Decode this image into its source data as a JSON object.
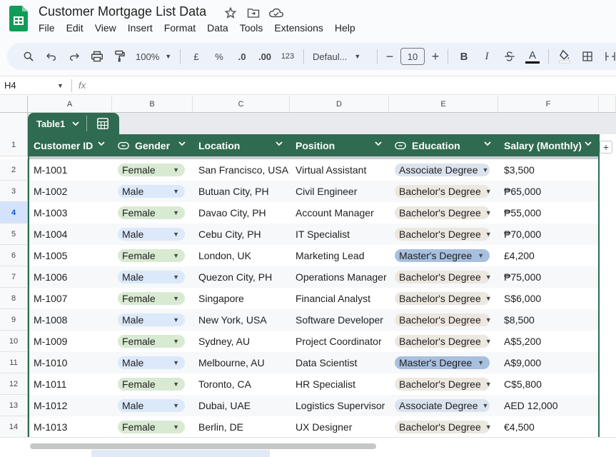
{
  "app": {
    "doc_title": "Customer Mortgage List Data",
    "brand_color": "#0f9d58",
    "title_icons": [
      "star-icon",
      "move-to-folder-icon",
      "cloud-status-icon"
    ]
  },
  "menu": [
    "File",
    "Edit",
    "View",
    "Insert",
    "Format",
    "Data",
    "Tools",
    "Extensions",
    "Help"
  ],
  "toolbar": {
    "zoom": "100%",
    "currency_label": "£",
    "percent_label": "%",
    "decrease_decimal_label": ".0",
    "increase_decimal_label": ".00",
    "number_format_label": "123",
    "font_label": "Defaul...",
    "font_size": "10",
    "minus_label": "−",
    "plus_label": "+",
    "bold_label": "B",
    "italic_label": "I",
    "text_color_label": "A"
  },
  "formula_bar": {
    "cell_ref": "H4",
    "fx_label": "fx",
    "value": ""
  },
  "columns": [
    "A",
    "B",
    "C",
    "D",
    "E",
    "F"
  ],
  "table": {
    "name": "Table1",
    "accent": "#2f6b51",
    "headers": [
      "Customer ID",
      "Gender",
      "Location",
      "Position",
      "Education",
      "Salary (Monthly)"
    ],
    "rows": [
      {
        "num": "2",
        "id": "M-1001",
        "gender": "Female",
        "location": "San Francisco, USA",
        "position": "Virtual Assistant",
        "education": "Associate Degree",
        "salary": "$3,500"
      },
      {
        "num": "3",
        "id": "M-1002",
        "gender": "Male",
        "location": "Butuan City, PH",
        "position": "Civil Engineer",
        "education": "Bachelor's Degree",
        "salary": "₱65,000"
      },
      {
        "num": "4",
        "id": "M-1003",
        "gender": "Female",
        "location": "Davao City, PH",
        "position": "Account Manager",
        "education": "Bachelor's Degree",
        "salary": "₱55,000"
      },
      {
        "num": "5",
        "id": "M-1004",
        "gender": "Male",
        "location": "Cebu City, PH",
        "position": "IT Specialist",
        "education": "Bachelor's Degree",
        "salary": "₱70,000"
      },
      {
        "num": "6",
        "id": "M-1005",
        "gender": "Female",
        "location": "London, UK",
        "position": "Marketing Lead",
        "education": "Master's Degree",
        "salary": "£4,200"
      },
      {
        "num": "7",
        "id": "M-1006",
        "gender": "Male",
        "location": "Quezon City, PH",
        "position": "Operations Manager",
        "education": "Bachelor's Degree",
        "salary": "₱75,000"
      },
      {
        "num": "8",
        "id": "M-1007",
        "gender": "Female",
        "location": "Singapore",
        "position": "Financial Analyst",
        "education": "Bachelor's Degree",
        "salary": "S$6,000"
      },
      {
        "num": "9",
        "id": "M-1008",
        "gender": "Male",
        "location": "New York, USA",
        "position": "Software Developer",
        "education": "Bachelor's Degree",
        "salary": "$8,500"
      },
      {
        "num": "10",
        "id": "M-1009",
        "gender": "Female",
        "location": "Sydney, AU",
        "position": "Project Coordinator",
        "education": "Bachelor's Degree",
        "salary": "A$5,200"
      },
      {
        "num": "11",
        "id": "M-1010",
        "gender": "Male",
        "location": "Melbourne, AU",
        "position": "Data Scientist",
        "education": "Master's Degree",
        "salary": "A$9,000"
      },
      {
        "num": "12",
        "id": "M-1011",
        "gender": "Female",
        "location": "Toronto, CA",
        "position": "HR Specialist",
        "education": "Bachelor's Degree",
        "salary": "C$5,800"
      },
      {
        "num": "13",
        "id": "M-1012",
        "gender": "Male",
        "location": "Dubai, UAE",
        "position": "Logistics Supervisor",
        "education": "Associate Degree",
        "salary": "AED 12,000"
      },
      {
        "num": "14",
        "id": "M-1013",
        "gender": "Female",
        "location": "Berlin, DE",
        "position": "UX Designer",
        "education": "Bachelor's Degree",
        "salary": "€4,500"
      }
    ]
  },
  "chip_colors": {
    "Female": "#d9ead3",
    "Male": "#dbe9fb",
    "Associate Degree": "#dbe3ee",
    "Bachelor's Degree": "#ece7df",
    "Master's Degree": "#a8c0df"
  },
  "active_row": "4"
}
